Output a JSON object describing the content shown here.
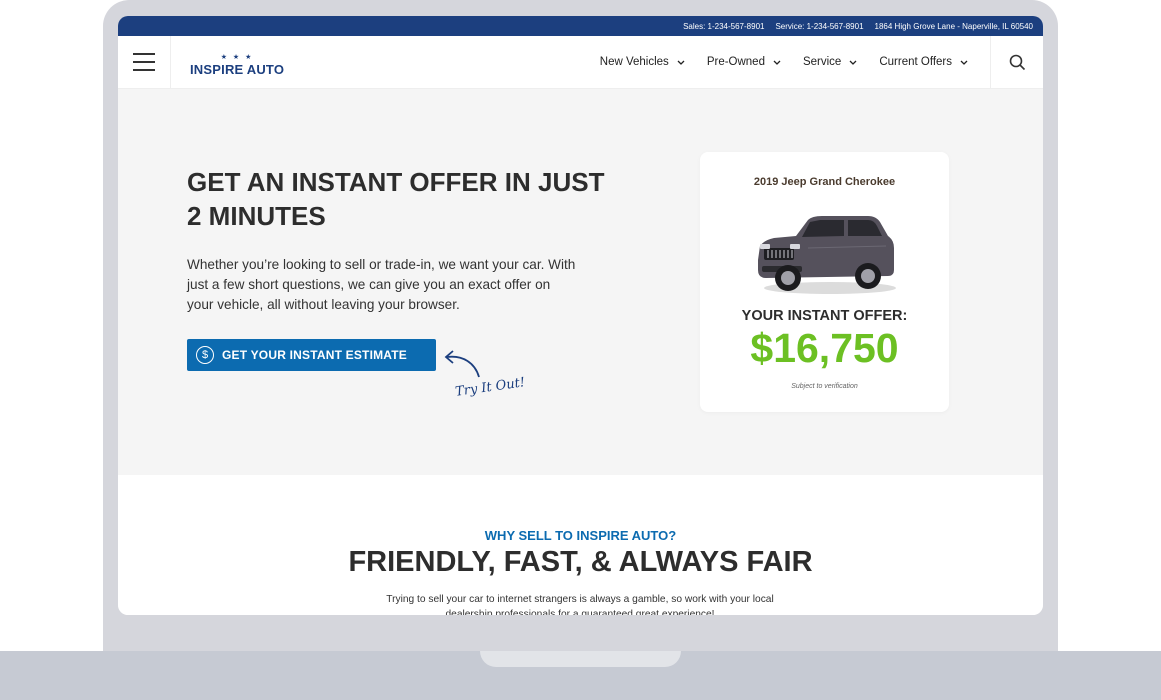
{
  "topbar": {
    "sales": "Sales: 1-234-567-8901",
    "service": "Service: 1-234-567-8901",
    "address": "1864 High Grove Lane - Naperville, IL 60540"
  },
  "navbar": {
    "menu_icon": "hamburger-menu-icon",
    "logo_text": "INSPIRE AUTO",
    "logo_stars": "★ ★ ★",
    "items": [
      {
        "label": "New Vehicles"
      },
      {
        "label": "Pre-Owned"
      },
      {
        "label": "Service"
      },
      {
        "label": "Current Offers"
      }
    ],
    "search_icon": "search-icon"
  },
  "hero": {
    "title": "GET AN INSTANT OFFER IN JUST 2 MINUTES",
    "description": "Whether you’re looking to sell or trade-in, we want your car. With just a few short questions, we can give you an exact offer on your vehicle, all without leaving your browser.",
    "cta_label": "GET YOUR INSTANT ESTIMATE",
    "cta_icon_glyph": "$",
    "try_text": "Try It Out!"
  },
  "offer_card": {
    "vehicle": "2019 Jeep Grand Cherokee",
    "label": "YOUR INSTANT OFFER:",
    "amount": "$16,750",
    "note": "Subject to verification"
  },
  "why": {
    "eyebrow": "WHY SELL TO INSPIRE AUTO?",
    "title": "FRIENDLY, FAST, & ALWAYS FAIR",
    "description": "Trying to sell your car to internet strangers is always a gamble, so work with your local dealership professionals for a guaranteed great experience!"
  },
  "colors": {
    "brand_navy": "#1c3f7f",
    "cta_blue": "#0c6bb0",
    "offer_green": "#6cc023"
  }
}
